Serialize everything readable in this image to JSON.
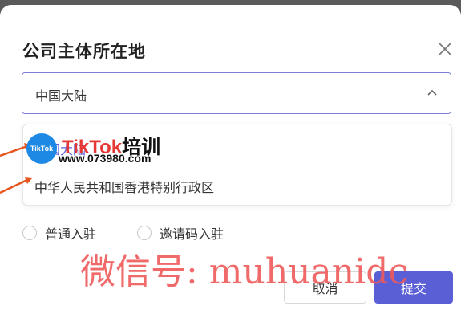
{
  "dialog": {
    "title": "公司主体所在地",
    "close_icon": "close-icon"
  },
  "location_select": {
    "value": "中国大陆",
    "icon": "chevron-up-icon",
    "options": [
      "中国大陆",
      "中华人民共和国香港特别行政区"
    ]
  },
  "entry_type": {
    "options": [
      "普通入驻",
      "邀请码入驻"
    ]
  },
  "buttons": {
    "cancel": "取消",
    "submit": "提交"
  },
  "overlay_logo": {
    "circle_text": "TikTok",
    "brand": "TikTok",
    "brand_cn": "培训",
    "url": "www.073980.com"
  },
  "watermark": "微信号: muhuanidc",
  "colors": {
    "accent": "#5b5fd6",
    "arrow": "#e8541e",
    "watermark": "#ef5a5a"
  }
}
